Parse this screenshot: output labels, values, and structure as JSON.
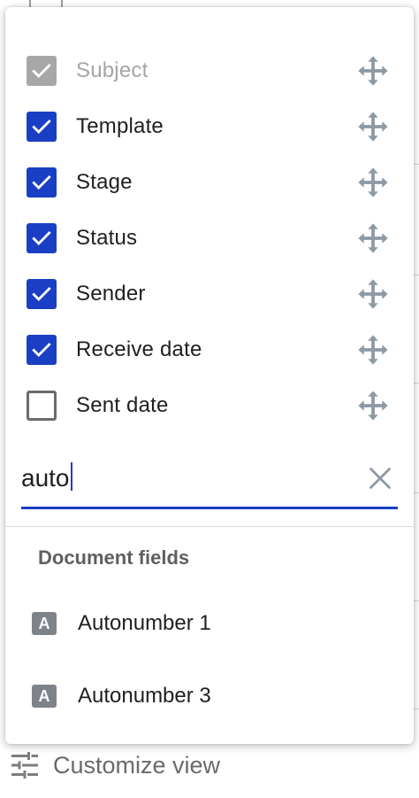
{
  "columns": [
    {
      "label": "Subject",
      "checked": true,
      "disabled": true
    },
    {
      "label": "Template",
      "checked": true,
      "disabled": false
    },
    {
      "label": "Stage",
      "checked": true,
      "disabled": false
    },
    {
      "label": "Status",
      "checked": true,
      "disabled": false
    },
    {
      "label": "Sender",
      "checked": true,
      "disabled": false
    },
    {
      "label": "Receive date",
      "checked": true,
      "disabled": false
    },
    {
      "label": "Sent date",
      "checked": false,
      "disabled": false
    }
  ],
  "search": {
    "value": "auto"
  },
  "document_fields": {
    "header": "Document fields",
    "items": [
      {
        "badge": "A",
        "label": "Autonumber 1"
      },
      {
        "badge": "A",
        "label": "Autonumber 3"
      }
    ]
  },
  "footer": {
    "customize_label": "Customize view"
  },
  "colors": {
    "accent": "#1a3fc4",
    "disabled_check": "#a7a7a7",
    "badge": "#7e8389",
    "icon_gray": "#8c9aa6"
  }
}
